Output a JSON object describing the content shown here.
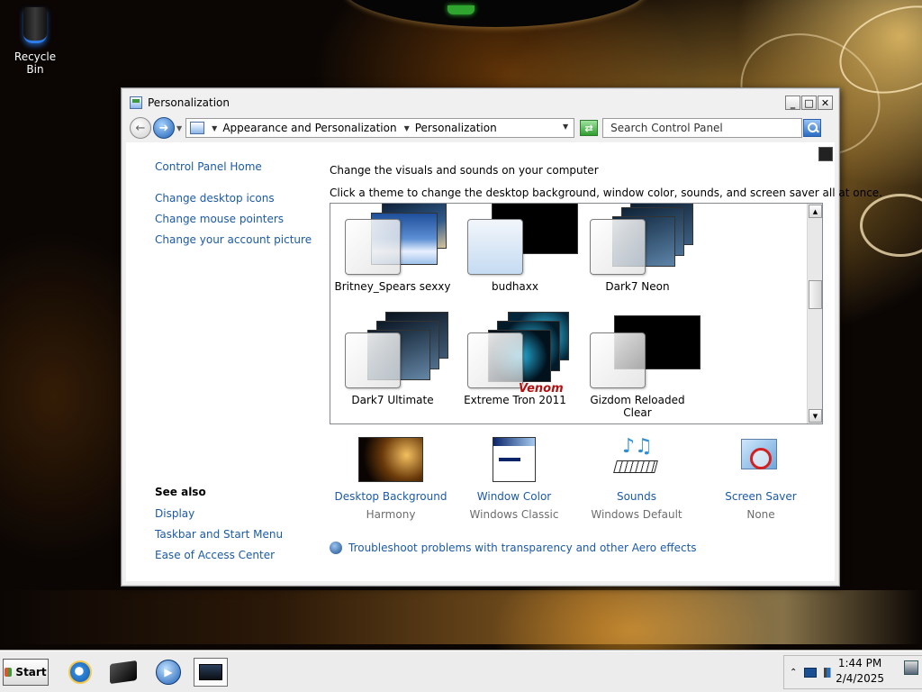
{
  "desktop": {
    "recycle_bin_label": "Recycle Bin"
  },
  "window": {
    "title": "Personalization",
    "minimize_glyph": "_",
    "maximize_glyph": "□",
    "close_glyph": "✕"
  },
  "navbar": {
    "back_glyph": "←",
    "forward_glyph": "➜",
    "breadcrumb": [
      "Appearance and Personalization",
      "Personalization"
    ],
    "search_placeholder": "Search Control Panel",
    "refresh_glyph": "⇄"
  },
  "left_pane": {
    "home_link": "Control Panel Home",
    "tasks": [
      "Change desktop icons",
      "Change mouse pointers",
      "Change your account picture"
    ],
    "see_also_title": "See also",
    "see_also": [
      "Display",
      "Taskbar and Start Menu",
      "Ease of Access Center"
    ]
  },
  "main": {
    "heading": "Change the visuals and sounds on your computer",
    "subheading": "Click a theme to change the desktop background, window color, sounds, and screen saver all at once.",
    "themes": [
      {
        "name": "Britney_Spears sexxy"
      },
      {
        "name": "budhaxx"
      },
      {
        "name": "Dark7 Neon"
      },
      {
        "name": "Dark7 Ultimate"
      },
      {
        "name": "Extreme Tron 2011"
      },
      {
        "name": "Gizdom Reloaded Clear"
      }
    ],
    "tron_watermark": "Venom",
    "settings": [
      {
        "label": "Desktop Background",
        "value": "Harmony"
      },
      {
        "label": "Window Color",
        "value": "Windows Classic"
      },
      {
        "label": "Sounds",
        "value": "Windows Default"
      },
      {
        "label": "Screen Saver",
        "value": "None"
      }
    ],
    "troubleshoot_link": "Troubleshoot problems with transparency and other Aero effects"
  },
  "taskbar": {
    "start_label": "Start",
    "pinned": [
      "internet-explorer-icon",
      "media-center-icon",
      "media-player-icon",
      "control-panel-icon"
    ],
    "time": "1:44 PM",
    "date": "2/4/2025"
  },
  "colors": {
    "link": "#1c5aa6",
    "muted": "#6d6d6d",
    "window_bg": "#f0f0f0"
  }
}
